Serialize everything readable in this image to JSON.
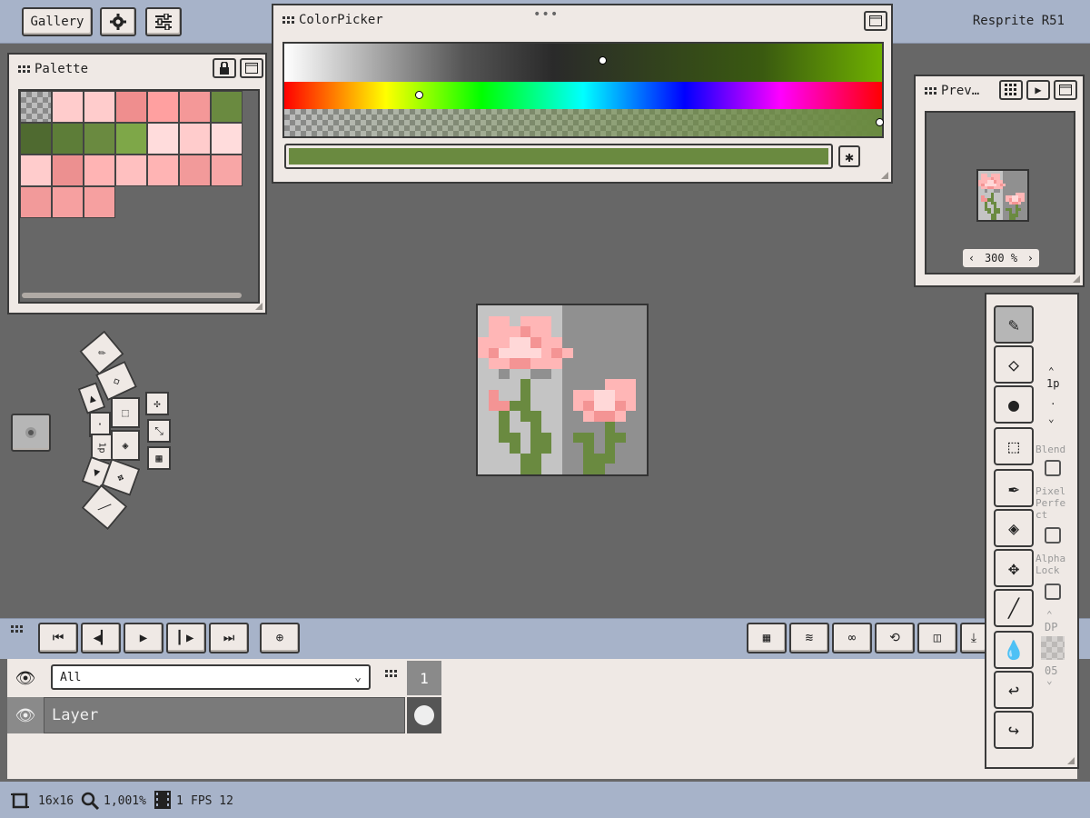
{
  "header": {
    "gallery_label": "Gallery",
    "settings_icon": "gear-icon",
    "adjust_icon": "sliders-icon",
    "version": "Resprite R51"
  },
  "palette_panel": {
    "title": "Palette",
    "lock_icon": "lock-icon",
    "menu_icon": "panel-menu-icon",
    "swatches": [
      "transparent",
      "#ffcccc",
      "#ffcccc",
      "#ef8e8e",
      "#ffa0a0",
      "#f49898",
      "#6a8a40",
      "#4f6a30",
      "#5d7d38",
      "#6a8a40",
      "#7ea748",
      "#ffdcdc",
      "#ffcccc",
      "#ffdcdc",
      "#ffcccc",
      "#ec9090",
      "#ffb4b4",
      "#ffc0c0",
      "#ffb4b4",
      "#f29a9a",
      "#f8a6a6",
      "#f29a9a",
      "#f6a0a0",
      "#f6a0a0"
    ]
  },
  "color_picker": {
    "title": "ColorPicker",
    "hex_value": "",
    "current_color": "#6a8a40",
    "dropper_icon": "asterisk-icon"
  },
  "preview_panel": {
    "title": "Prev…",
    "zoom_label": "300 %",
    "zoom_prev": "‹",
    "zoom_next": "›"
  },
  "tools": {
    "brush_size": "1p",
    "blend_label": "Blend",
    "pixel_perfect_label": "Pixel Perfe ct",
    "alpha_lock_label": "Alpha Lock",
    "dp_label": "DP",
    "dp_value": "05",
    "items": [
      "pencil-icon",
      "eraser-icon",
      "sphere-icon",
      "selection-icon",
      "eyedropper-icon",
      "fill-bucket-icon",
      "move-icon",
      "line-icon",
      "smudge-icon",
      "undo-icon",
      "redo-icon"
    ]
  },
  "radial_menu": {
    "center_label": "1p",
    "dot": "·"
  },
  "timeline": {
    "layer_filter": "All",
    "frame_number": "1",
    "layer_name": "Layer"
  },
  "status": {
    "canvas_size": "16x16",
    "zoom": "1,001%",
    "frames": "1",
    "fps": "FPS 12"
  },
  "colors": {
    "pink_light": "#ffb6b6",
    "pink": "#f49494",
    "pink_pale": "#ffd8d8",
    "green": "#6a8a40",
    "green_dark": "#4f6a30",
    "bg_light": "#c4c4c4",
    "bg_dark": "#909090"
  }
}
